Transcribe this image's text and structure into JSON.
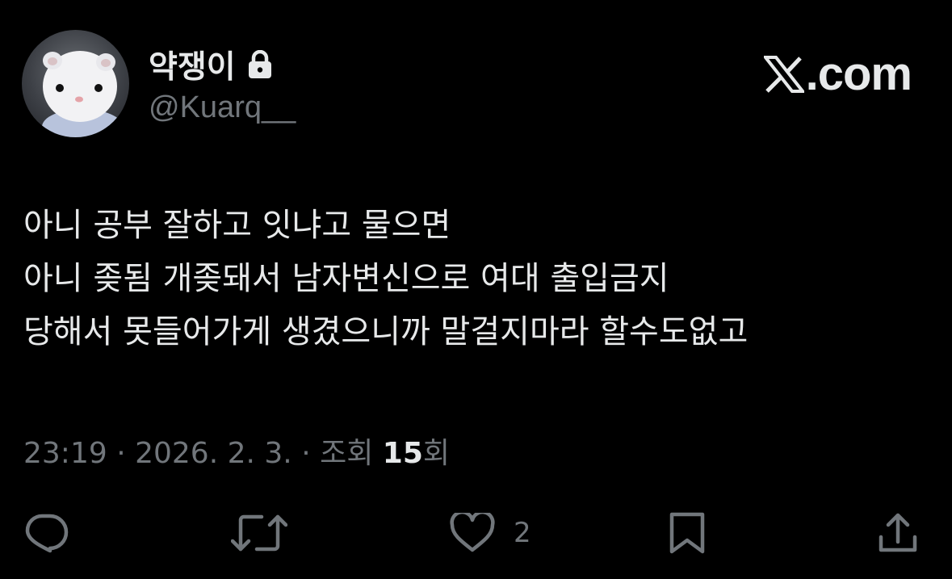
{
  "author": {
    "display_name": "약쟁이",
    "handle": "@Kuarq__",
    "protected_icon": "lock-icon",
    "avatar": "white-fluffy-hamster-avatar"
  },
  "brand": {
    "logo": "x-logo-icon",
    "suffix": ".com"
  },
  "tweet": {
    "lines": [
      "아니 공부 잘하고 잇냐고 물으면",
      "아니 좆됨 개좆돼서 남자변신으로 여대 출입금지",
      "당해서 못들어가게 생겼으니까 말걸지마라 할수도없고"
    ]
  },
  "meta": {
    "time": "23:19",
    "separator": " · ",
    "date": "2026. 2. 3.",
    "views_label": "조회 ",
    "views_count": "15",
    "views_suffix": "회"
  },
  "actions": {
    "reply_icon": "reply-icon",
    "retweet_icon": "retweet-icon",
    "like_icon": "heart-icon",
    "like_count": "2",
    "bookmark_icon": "bookmark-icon",
    "share_icon": "share-icon"
  },
  "colors": {
    "background": "#000000",
    "primary_text": "#e7e9ea",
    "secondary_text": "#71767b"
  }
}
